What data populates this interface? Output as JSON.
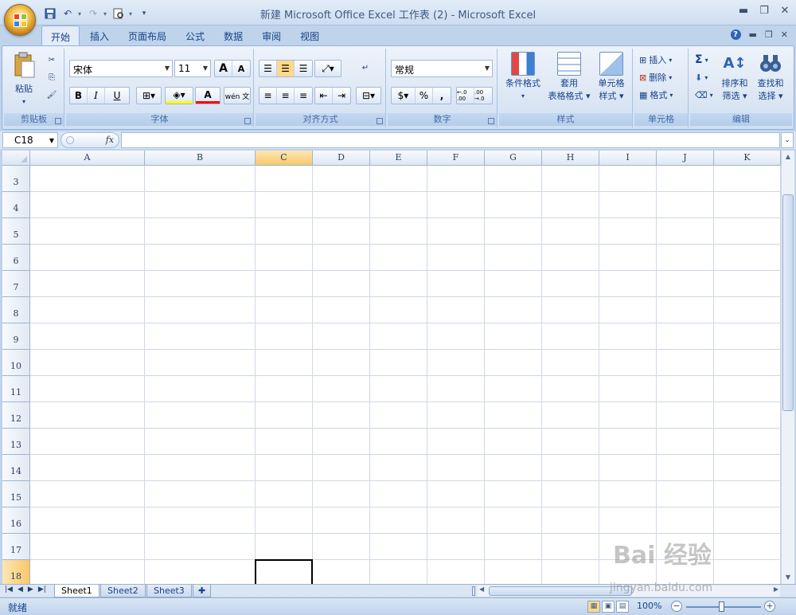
{
  "window": {
    "title": "新建 Microsoft Office Excel 工作表 (2) - Microsoft Excel"
  },
  "tabs": [
    "开始",
    "插入",
    "页面布局",
    "公式",
    "数据",
    "审阅",
    "视图"
  ],
  "ribbon": {
    "clipboard": {
      "name": "剪贴板",
      "paste": "粘贴"
    },
    "font": {
      "name": "字体",
      "family": "宋体",
      "size": "11",
      "bold": "B",
      "italic": "I",
      "underline": "U",
      "grow": "A",
      "shrink": "A",
      "color_letter": "A",
      "phonetic": "wén 文"
    },
    "alignment": {
      "name": "对齐方式"
    },
    "number": {
      "name": "数字",
      "format": "常规",
      "percent": "%",
      "comma": ",",
      "inc_decimal": "←.0 .00",
      "dec_decimal": ".00 →.0"
    },
    "styles": {
      "name": "样式",
      "conditional": "条件格式",
      "table_l1": "套用",
      "table_l2": "表格格式",
      "cell_l1": "单元格",
      "cell_l2": "样式"
    },
    "cells": {
      "name": "单元格",
      "insert": "插入",
      "delete": "删除",
      "format": "格式"
    },
    "editing": {
      "name": "编辑",
      "sum": "Σ",
      "sort_l1": "排序和",
      "sort_l2": "筛选",
      "find_l1": "查找和",
      "find_l2": "选择"
    }
  },
  "formula_bar": {
    "name_box": "C18",
    "fx": "fx",
    "formula": ""
  },
  "columns": [
    "A",
    "B",
    "C",
    "D",
    "E",
    "F",
    "G",
    "H",
    "I",
    "J",
    "K"
  ],
  "rows": [
    "3",
    "4",
    "5",
    "6",
    "7",
    "8",
    "9",
    "10",
    "11",
    "12",
    "13",
    "14",
    "15",
    "16",
    "17",
    "18"
  ],
  "selected": {
    "column": "C",
    "row": "18"
  },
  "sheets": [
    "Sheet1",
    "Sheet2",
    "Sheet3"
  ],
  "status": {
    "ready": "就绪",
    "zoom": "100%"
  },
  "watermark": {
    "line1": "Bai 经验",
    "line2": "jingyan.baidu.com"
  }
}
